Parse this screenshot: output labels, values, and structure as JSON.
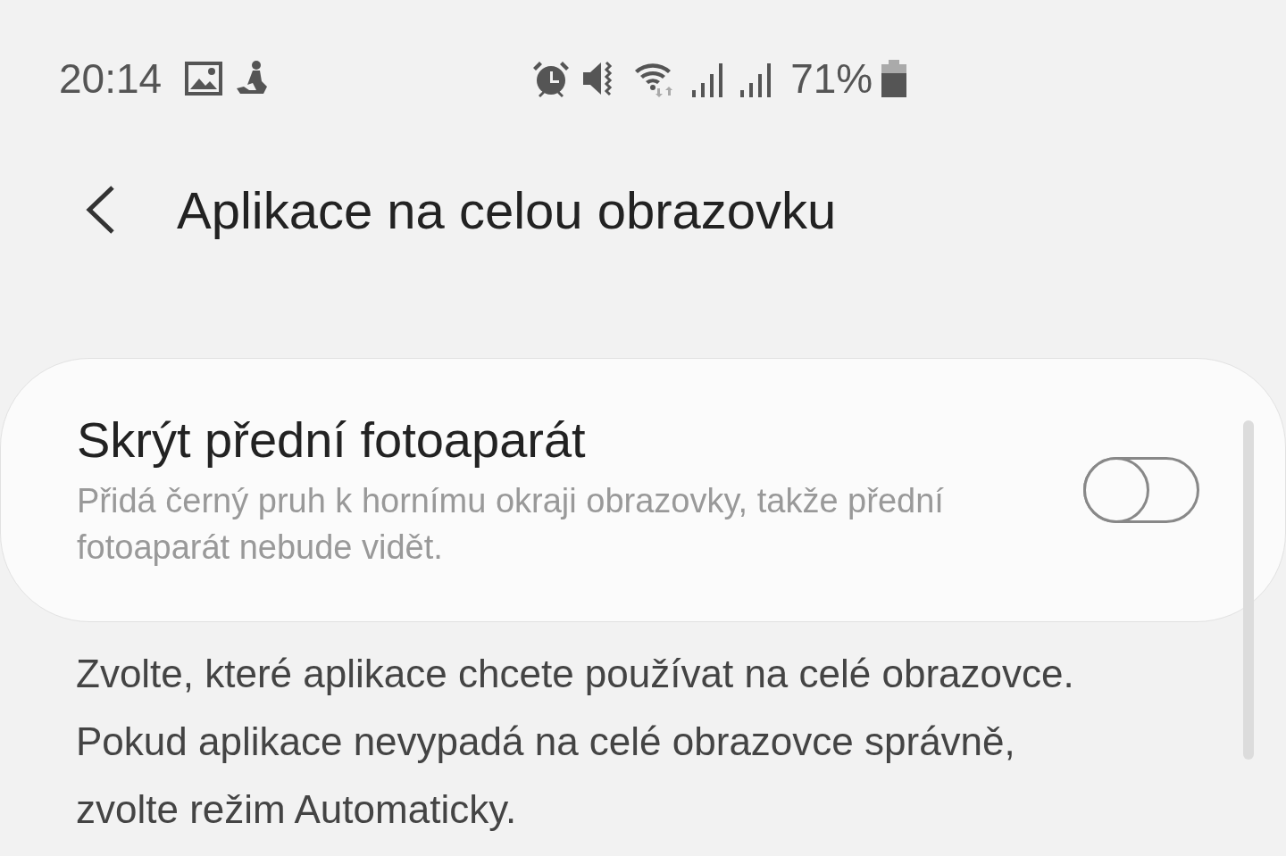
{
  "status_bar": {
    "time": "20:14",
    "battery": "71%"
  },
  "header": {
    "title": "Aplikace na celou obrazovku"
  },
  "setting": {
    "title": "Skrýt přední fotoaparát",
    "description": "Přidá černý pruh k hornímu okraji obrazovky, takže přední fotoaparát nebude vidět.",
    "on": false
  },
  "info": "Zvolte, které aplikace chcete používat na celé obrazovce. Pokud aplikace nevypadá na celé obrazovce správně, zvolte režim Automaticky."
}
